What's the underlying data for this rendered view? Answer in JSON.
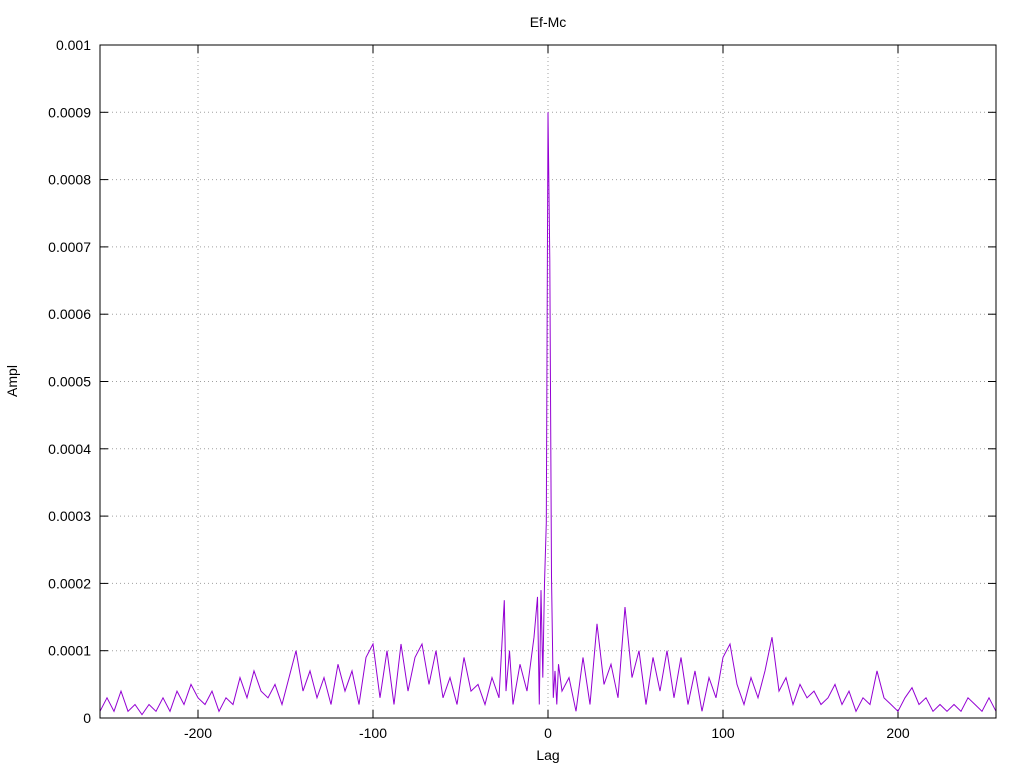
{
  "chart_data": {
    "type": "line",
    "title": "Ef-Mc",
    "xlabel": "Lag",
    "ylabel": "Ampl",
    "xlim": [
      -256,
      256
    ],
    "ylim": [
      0,
      0.001
    ],
    "grid": true,
    "x_ticks": [
      -200,
      -100,
      0,
      100,
      200
    ],
    "x_tick_labels": [
      "-200",
      "-100",
      "0",
      "100",
      "200"
    ],
    "y_ticks": [
      0,
      0.0001,
      0.0002,
      0.0003,
      0.0004,
      0.0005,
      0.0006,
      0.0007,
      0.0008,
      0.0009,
      0.001
    ],
    "y_tick_labels": [
      "0",
      "0.0001",
      "0.0002",
      "0.0003",
      "0.0004",
      "0.0005",
      "0.0006",
      "0.0007",
      "0.0008",
      "0.0009",
      "0.001"
    ],
    "series": [
      {
        "color": "#9400d3",
        "x": [
          -256,
          -252,
          -248,
          -244,
          -240,
          -236,
          -232,
          -228,
          -224,
          -220,
          -216,
          -212,
          -208,
          -204,
          -200,
          -196,
          -192,
          -188,
          -184,
          -180,
          -176,
          -172,
          -168,
          -164,
          -160,
          -156,
          -152,
          -148,
          -144,
          -140,
          -136,
          -132,
          -128,
          -124,
          -120,
          -116,
          -112,
          -108,
          -104,
          -100,
          -96,
          -92,
          -88,
          -84,
          -80,
          -76,
          -72,
          -68,
          -64,
          -60,
          -56,
          -52,
          -48,
          -44,
          -40,
          -36,
          -32,
          -28,
          -25,
          -24,
          -22,
          -20,
          -16,
          -12,
          -8,
          -6,
          -5,
          -4,
          -3,
          -2,
          -1,
          0,
          1,
          2,
          3,
          4,
          5,
          6,
          8,
          12,
          16,
          20,
          24,
          28,
          32,
          36,
          40,
          44,
          48,
          52,
          56,
          60,
          64,
          68,
          72,
          76,
          80,
          84,
          88,
          92,
          96,
          100,
          104,
          108,
          112,
          116,
          120,
          124,
          128,
          132,
          136,
          140,
          144,
          148,
          152,
          156,
          160,
          164,
          168,
          172,
          176,
          180,
          184,
          188,
          192,
          196,
          200,
          204,
          208,
          212,
          216,
          220,
          224,
          228,
          232,
          236,
          240,
          244,
          248,
          252,
          256
        ],
        "y": [
          1e-05,
          3e-05,
          1e-05,
          4e-05,
          1e-05,
          2e-05,
          5e-06,
          2e-05,
          1e-05,
          3e-05,
          1e-05,
          4e-05,
          2e-05,
          5e-05,
          3e-05,
          2e-05,
          4e-05,
          1e-05,
          3e-05,
          2e-05,
          6e-05,
          3e-05,
          7e-05,
          4e-05,
          3e-05,
          5e-05,
          2e-05,
          6e-05,
          0.0001,
          4e-05,
          7e-05,
          3e-05,
          6e-05,
          2e-05,
          8e-05,
          4e-05,
          7e-05,
          2e-05,
          9e-05,
          0.00011,
          3e-05,
          0.0001,
          2e-05,
          0.00011,
          4e-05,
          9e-05,
          0.00011,
          5e-05,
          0.0001,
          3e-05,
          6e-05,
          2e-05,
          9e-05,
          4e-05,
          5e-05,
          2e-05,
          6e-05,
          3e-05,
          0.000175,
          4e-05,
          0.0001,
          2e-05,
          8e-05,
          4e-05,
          0.00012,
          0.00018,
          2e-05,
          0.00019,
          6e-05,
          0.0002,
          0.00029,
          0.0009,
          0.00068,
          0.00021,
          3e-05,
          7e-05,
          2e-05,
          8e-05,
          4e-05,
          6e-05,
          1e-05,
          9e-05,
          2e-05,
          0.00014,
          5e-05,
          8e-05,
          3e-05,
          0.000165,
          6e-05,
          0.0001,
          2e-05,
          9e-05,
          4e-05,
          0.0001,
          3e-05,
          9e-05,
          2e-05,
          7e-05,
          1e-05,
          6e-05,
          3e-05,
          9e-05,
          0.00011,
          5e-05,
          2e-05,
          6e-05,
          3e-05,
          7e-05,
          0.00012,
          4e-05,
          6e-05,
          2e-05,
          5e-05,
          3e-05,
          4e-05,
          2e-05,
          3e-05,
          5e-05,
          2e-05,
          4e-05,
          1e-05,
          3e-05,
          2e-05,
          7e-05,
          3e-05,
          2e-05,
          1e-05,
          3e-05,
          4.5e-05,
          2e-05,
          3e-05,
          1e-05,
          2e-05,
          1e-05,
          2e-05,
          1e-05,
          3e-05,
          2e-05,
          1e-05,
          3e-05,
          1e-05
        ]
      }
    ]
  }
}
